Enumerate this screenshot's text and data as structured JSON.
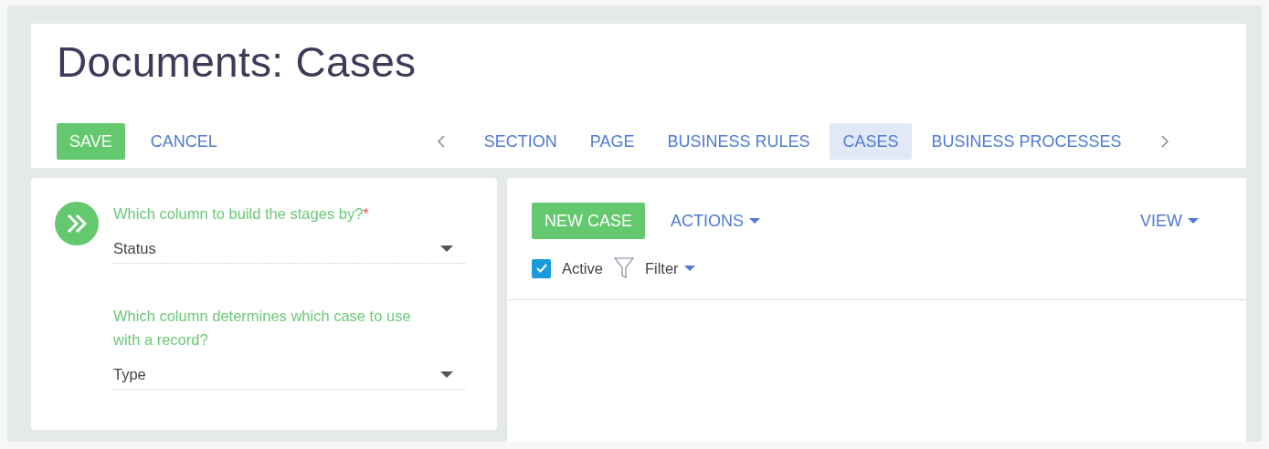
{
  "title": "Documents: Cases",
  "toolbar": {
    "save": "SAVE",
    "cancel": "CANCEL"
  },
  "tabs": [
    {
      "label": "SECTION",
      "selected": false
    },
    {
      "label": "PAGE",
      "selected": false
    },
    {
      "label": "BUSINESS RULES",
      "selected": false
    },
    {
      "label": "CASES",
      "selected": true
    },
    {
      "label": "BUSINESS PROCESSES",
      "selected": false
    }
  ],
  "settings": [
    {
      "question": "Which column to build the stages by?",
      "required": true,
      "required_mark": "*",
      "value": "Status"
    },
    {
      "question": "Which column determines which case to use with a record?",
      "value": "Type"
    }
  ],
  "cases": {
    "new_case": "NEW CASE",
    "actions": "ACTIONS",
    "view": "VIEW",
    "active": {
      "label": "Active",
      "checked": true
    },
    "filter": "Filter"
  }
}
